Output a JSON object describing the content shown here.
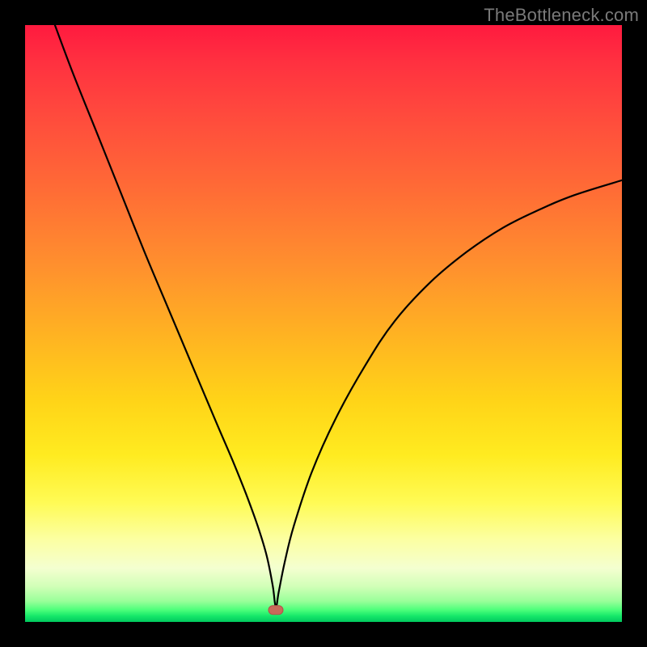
{
  "watermark": "TheBottleneck.com",
  "colors": {
    "frame": "#000000",
    "curve": "#000000",
    "marker_fill": "#c96a5a",
    "marker_stroke": "#b25348"
  },
  "chart_data": {
    "type": "line",
    "title": "",
    "xlabel": "",
    "ylabel": "",
    "xlim": [
      0,
      100
    ],
    "ylim": [
      0,
      100
    ],
    "annotations": [
      {
        "kind": "marker",
        "x": 42,
        "y": 2
      }
    ],
    "series": [
      {
        "name": "bottleneck-curve",
        "x": [
          5,
          8,
          12,
          16,
          20,
          24,
          28,
          32,
          35,
          37,
          39,
          40.5,
          41.5,
          42,
          42.5,
          43.5,
          45,
          48,
          52,
          57,
          62,
          68,
          74,
          80,
          86,
          92,
          100
        ],
        "y": [
          100,
          92,
          82,
          72,
          62,
          52.5,
          43,
          33.5,
          26.5,
          21.5,
          16,
          11,
          6,
          2.5,
          5,
          10,
          16,
          25,
          34,
          43,
          50.5,
          57,
          62,
          66,
          69,
          71.5,
          74
        ]
      }
    ]
  }
}
